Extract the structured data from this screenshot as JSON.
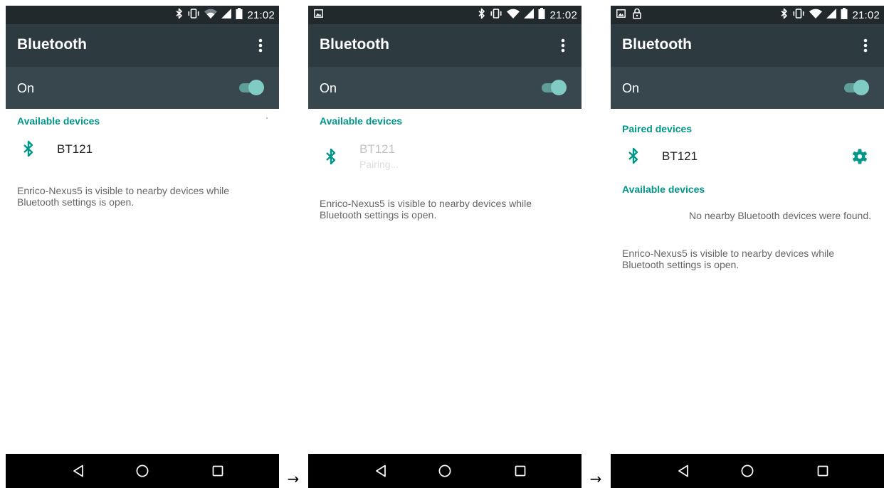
{
  "screens": [
    {
      "status_bar": {
        "time": "21:02",
        "left_icons": [],
        "right_icons": [
          "bluetooth-icon",
          "vibrate-icon",
          "wifi-icon",
          "signal-icon",
          "battery-icon"
        ]
      },
      "app_bar": {
        "title": "Bluetooth",
        "overflow_icon": "more-vert-icon"
      },
      "toggle": {
        "label": "On",
        "state": "on"
      },
      "available_devices": {
        "header": "Available devices",
        "devices": [
          {
            "name": "BT121",
            "status": "",
            "icon": "bluetooth-icon"
          }
        ]
      },
      "visibility_text": "Enrico-Nexus5 is visible to nearby devices while Bluetooth settings is open."
    },
    {
      "status_bar": {
        "time": "21:02",
        "left_icons": [
          "image-icon"
        ],
        "right_icons": [
          "bluetooth-icon",
          "vibrate-icon",
          "wifi-icon",
          "signal-icon",
          "battery-icon"
        ]
      },
      "app_bar": {
        "title": "Bluetooth",
        "overflow_icon": "more-vert-icon"
      },
      "toggle": {
        "label": "On",
        "state": "on"
      },
      "available_devices": {
        "header": "Available devices",
        "devices": [
          {
            "name": "BT121",
            "status": "Pairing...",
            "icon": "bluetooth-icon"
          }
        ]
      },
      "visibility_text": "Enrico-Nexus5 is visible to nearby devices while Bluetooth settings is open."
    },
    {
      "status_bar": {
        "time": "21:02",
        "left_icons": [
          "image-icon",
          "lock-icon"
        ],
        "right_icons": [
          "bluetooth-icon",
          "vibrate-icon",
          "wifi-icon",
          "signal-icon",
          "battery-icon"
        ]
      },
      "app_bar": {
        "title": "Bluetooth",
        "overflow_icon": "more-vert-icon"
      },
      "toggle": {
        "label": "On",
        "state": "on"
      },
      "paired_devices": {
        "header": "Paired devices",
        "devices": [
          {
            "name": "BT121",
            "icon": "bluetooth-icon",
            "action_icon": "gear-icon"
          }
        ]
      },
      "available_devices": {
        "header": "Available devices",
        "empty_message": "No nearby Bluetooth devices were found."
      },
      "visibility_text": "Enrico-Nexus5 is visible to nearby devices while Bluetooth settings is open."
    }
  ],
  "nav_bar": {
    "buttons": [
      "back-icon",
      "home-icon",
      "recents-icon"
    ]
  },
  "flow_arrows": [
    "→",
    "→"
  ],
  "colors": {
    "status_bar": "#21292d",
    "app_bar": "#2d3a40",
    "toggle_bar": "#38474e",
    "accent": "#009688",
    "switch_thumb": "#80cbc4",
    "nav_bar": "#000000"
  }
}
